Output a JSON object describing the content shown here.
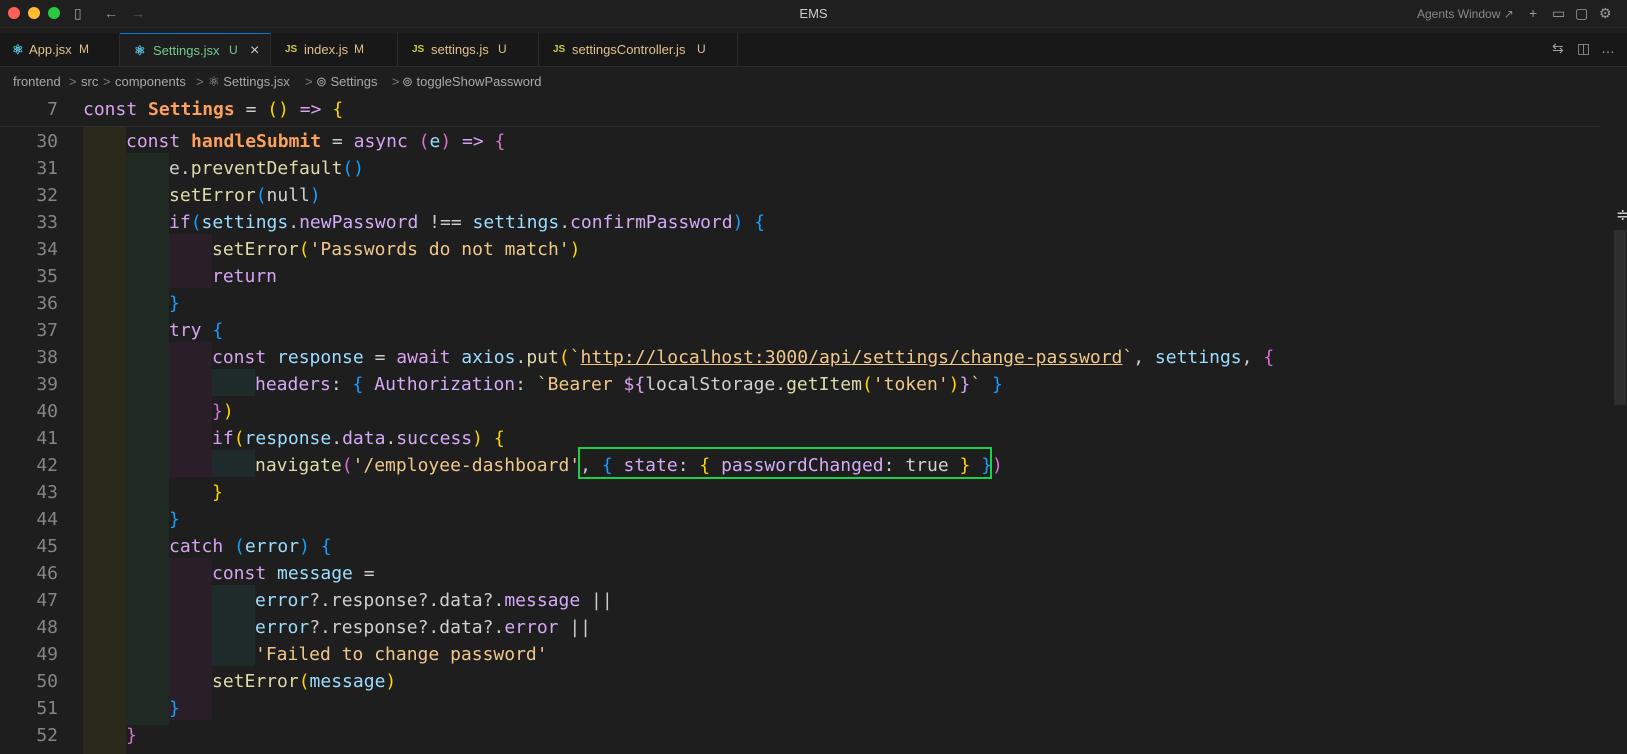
{
  "window": {
    "title": "EMS",
    "agents_label": "Agents Window ↗"
  },
  "titlebar_icons": {
    "sidebar": "▯",
    "back": "←",
    "forward": "→",
    "plus": "+",
    "panel": "▭",
    "chat": "▢",
    "gear": "⚙"
  },
  "tabs": [
    {
      "icon": "react-icon",
      "glyph": "⚛",
      "name": "App.jsx",
      "badge": "M"
    },
    {
      "icon": "react-icon",
      "glyph": "⚛",
      "name": "Settings.jsx",
      "badge": "U",
      "close": "×"
    },
    {
      "icon": "js-icon",
      "glyph": "JS",
      "name": "index.js",
      "badge": "M"
    },
    {
      "icon": "js-icon",
      "glyph": "JS",
      "name": "settings.js",
      "badge": "U"
    },
    {
      "icon": "js-icon",
      "glyph": "JS",
      "name": "settingsController.js",
      "badge": "U"
    }
  ],
  "tab_actions": {
    "compare": "⇆",
    "split": "◫",
    "more": "…"
  },
  "breadcrumb": {
    "items": [
      "frontend",
      "src",
      "components",
      "⚛ Settings.jsx",
      "⊚ Settings",
      "⊚ toggleShowPassword"
    ],
    "sep": ">"
  },
  "code": {
    "sticky": {
      "num": "7",
      "text": "const Settings = () => {"
    },
    "lines": [
      {
        "num": "30",
        "text": "const handleSubmit = async (e) => {"
      },
      {
        "num": "31",
        "text": "e.preventDefault()"
      },
      {
        "num": "32",
        "text": "setError(null)"
      },
      {
        "num": "33",
        "text": "if(settings.newPassword !== settings.confirmPassword) {"
      },
      {
        "num": "34",
        "text": "setError('Passwords do not match')"
      },
      {
        "num": "35",
        "text": "return"
      },
      {
        "num": "36",
        "text": "}"
      },
      {
        "num": "37",
        "text": "try {"
      },
      {
        "num": "38",
        "text": "const response = await axios.put(`http://localhost:3000/api/settings/change-password`, settings, {"
      },
      {
        "num": "39",
        "text": "headers: { Authorization: `Bearer ${localStorage.getItem('token')}` }"
      },
      {
        "num": "40",
        "text": "})"
      },
      {
        "num": "41",
        "text": "if(response.data.success) {"
      },
      {
        "num": "42",
        "text": "navigate('/employee-dashboard', { state: { passwordChanged: true } })"
      },
      {
        "num": "43",
        "text": "}"
      },
      {
        "num": "44",
        "text": "}"
      },
      {
        "num": "45",
        "text": "catch (error) {"
      },
      {
        "num": "46",
        "text": "const message ="
      },
      {
        "num": "47",
        "text": "error?.response?.data?.message ||"
      },
      {
        "num": "48",
        "text": "error?.response?.data?.error ||"
      },
      {
        "num": "49",
        "text": "'Failed to change password'"
      },
      {
        "num": "50",
        "text": "setError(message)"
      },
      {
        "num": "51",
        "text": "}"
      },
      {
        "num": "52",
        "text": "}"
      }
    ]
  },
  "scroll_marker": "≑"
}
